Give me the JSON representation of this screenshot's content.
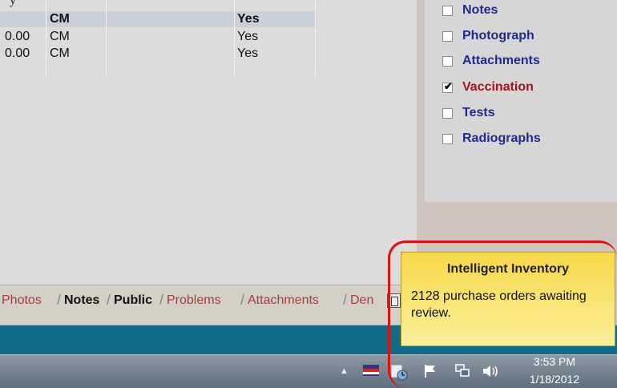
{
  "grid": {
    "peek_text": "y",
    "header": {
      "col1": "CM",
      "col2": "Yes"
    },
    "rows": [
      {
        "col0": "0.00",
        "col1": "CM",
        "col2": "Yes"
      },
      {
        "col0": "0.00",
        "col1": "CM",
        "col2": "Yes"
      }
    ]
  },
  "checklist": [
    {
      "label": "Notes",
      "checked": false
    },
    {
      "label": "Photograph",
      "checked": false
    },
    {
      "label": "Attachments",
      "checked": false
    },
    {
      "label": "Vaccination",
      "checked": true
    },
    {
      "label": "Tests",
      "checked": false
    },
    {
      "label": "Radiographs",
      "checked": false
    }
  ],
  "tabs": [
    {
      "label": "Photos"
    },
    {
      "label": "Notes"
    },
    {
      "label": "Public"
    },
    {
      "label": "Problems"
    },
    {
      "label": "Attachments"
    },
    {
      "label": "Den"
    }
  ],
  "notification": {
    "title": "Intelligent Inventory",
    "message": "2128 purchase orders awaiting review."
  },
  "taskbar": {
    "time": "3:53 PM",
    "date": "1/18/2012",
    "icons": [
      "show-hidden-icons-arrow",
      "app-tray-icon",
      "intelligent-inventory-tray-icon",
      "action-center-flag-icon",
      "network-icon",
      "volume-icon"
    ]
  },
  "colors": {
    "status_bar": "#0f6b86",
    "balloon_top": "#f7d84a",
    "annotation_ring": "#e01010",
    "checklist_label": "#1e2a8c",
    "checklist_alert": "#a0141c"
  }
}
